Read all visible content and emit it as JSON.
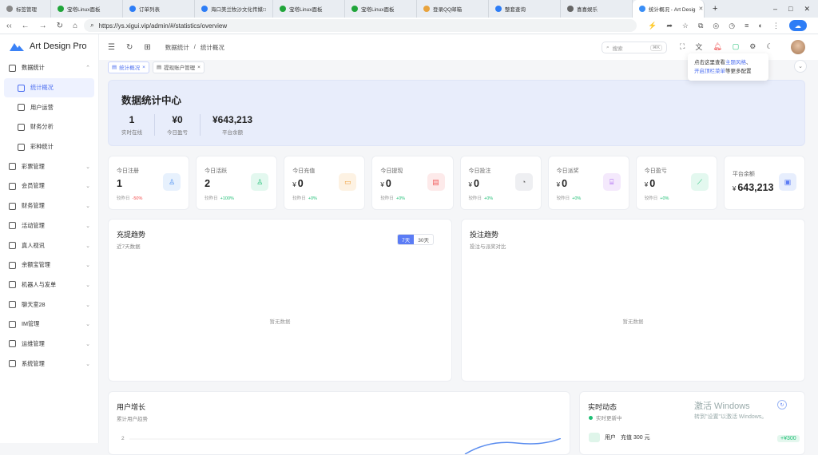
{
  "browser": {
    "tabs": [
      {
        "label": "标签管理",
        "color": "#888888"
      },
      {
        "label": "宝塔Linux面板",
        "color": "#20a53a"
      },
      {
        "label": "订单列表",
        "color": "#2d7df6"
      },
      {
        "label": "海口美兰牧沙文化传媒□",
        "color": "#2d7df6"
      },
      {
        "label": "宝塔Linux面板",
        "color": "#20a53a"
      },
      {
        "label": "宝塔Linux面板",
        "color": "#20a53a"
      },
      {
        "label": "登录QQ邮箱",
        "color": "#e8a33d"
      },
      {
        "label": "整套查询",
        "color": "#2d7df6"
      },
      {
        "label": "喜喜娱乐",
        "color": "#666666"
      },
      {
        "label": "统计概况 - Art Desig",
        "color": "#3a8ef6"
      }
    ],
    "url": "https://ys.xigui.vip/admin/#/statistics/overview"
  },
  "app": {
    "name": "Art Design Pro",
    "accent": "#4d6ff0"
  },
  "sidebar": {
    "items": [
      {
        "label": "数据统计",
        "icon": "chart-icon",
        "sub": false,
        "active": false,
        "expanded": true
      },
      {
        "label": "统计概况",
        "icon": "grid-icon",
        "sub": true,
        "active": true
      },
      {
        "label": "用户运营",
        "icon": "user-icon",
        "sub": true,
        "active": false
      },
      {
        "label": "财务分析",
        "icon": "coin-icon",
        "sub": true,
        "active": false
      },
      {
        "label": "彩种统计",
        "icon": "list-icon",
        "sub": true,
        "active": false
      },
      {
        "label": "彩票管理",
        "icon": "ticket-icon",
        "sub": false,
        "active": false
      },
      {
        "label": "会员管理",
        "icon": "member-icon",
        "sub": false,
        "active": false
      },
      {
        "label": "财务管理",
        "icon": "wallet-icon",
        "sub": false,
        "active": false
      },
      {
        "label": "活动管理",
        "icon": "gift-icon",
        "sub": false,
        "active": false
      },
      {
        "label": "真人视讯",
        "icon": "video-icon",
        "sub": false,
        "active": false
      },
      {
        "label": "余额宝管理",
        "icon": "bank-icon",
        "sub": false,
        "active": false
      },
      {
        "label": "机器人与发单",
        "icon": "robot-icon",
        "sub": false,
        "active": false
      },
      {
        "label": "聊天室28",
        "icon": "chat-icon",
        "sub": false,
        "active": false
      },
      {
        "label": "IM管理",
        "icon": "message-icon",
        "sub": false,
        "active": false
      },
      {
        "label": "运维管理",
        "icon": "tools-icon",
        "sub": false,
        "active": false
      },
      {
        "label": "系统管理",
        "icon": "settings-icon",
        "sub": false,
        "active": false
      }
    ]
  },
  "header": {
    "breadcrumb": [
      "数据统计",
      "统计概况"
    ],
    "search_placeholder": "搜索",
    "search_kbd": "⌘K"
  },
  "tooltip": {
    "line1_prefix": "点击这里查看",
    "line1_link": "主题风格",
    "line1_suffix": "、",
    "line2_link": "开启顶栏菜单",
    "line2_suffix": "等更多配置"
  },
  "open_tabs": [
    {
      "label": "统计概况",
      "active": true
    },
    {
      "label": "提现账户管理",
      "active": false
    }
  ],
  "banner": {
    "title": "数据统计中心",
    "stats": [
      {
        "value": "1",
        "label": "实时在线"
      },
      {
        "value": "¥0",
        "label": "今日盈亏"
      },
      {
        "value": "¥643,213",
        "label": "平台余额"
      }
    ]
  },
  "cards": [
    {
      "title": "今日注册",
      "value": "1",
      "currency": "",
      "compare_label": "较昨日",
      "compare": "-50%",
      "trend": "neg",
      "icon": "user-icon",
      "bg": "#e7f1fd",
      "fg": "#4a8ff0"
    },
    {
      "title": "今日活跃",
      "value": "2",
      "currency": "",
      "compare_label": "较昨日",
      "compare": "+100%",
      "trend": "pos",
      "icon": "user-check-icon",
      "bg": "#e3f8ef",
      "fg": "#1fbf75"
    },
    {
      "title": "今日充值",
      "value": "0",
      "currency": "¥",
      "compare_label": "较昨日",
      "compare": "+0%",
      "trend": "pos",
      "icon": "wallet-icon",
      "bg": "#fdf2e3",
      "fg": "#f0a13a"
    },
    {
      "title": "今日提现",
      "value": "0",
      "currency": "¥",
      "compare_label": "较昨日",
      "compare": "+0%",
      "trend": "pos",
      "icon": "card-icon",
      "bg": "#fdeaea",
      "fg": "#f15b5b"
    },
    {
      "title": "今日投注",
      "value": "0",
      "currency": "¥",
      "compare_label": "较昨日",
      "compare": "+0%",
      "trend": "pos",
      "icon": "pie-icon",
      "bg": "#eeeff2",
      "fg": "#666666"
    },
    {
      "title": "今日派奖",
      "value": "0",
      "currency": "¥",
      "compare_label": "较昨日",
      "compare": "+0%",
      "trend": "pos",
      "icon": "gift-icon",
      "bg": "#f4e9fc",
      "fg": "#a45bf0"
    },
    {
      "title": "今日盈亏",
      "value": "0",
      "currency": "¥",
      "compare_label": "较昨日",
      "compare": "+0%",
      "trend": "pos",
      "icon": "line-chart-icon",
      "bg": "#e3f8ef",
      "fg": "#1fbf75"
    },
    {
      "title": "平台余额",
      "value": "643,213",
      "currency": "¥",
      "compare_label": "",
      "compare": "",
      "trend": "",
      "icon": "balance-icon",
      "bg": "#e7eefd",
      "fg": "#5b7cf5"
    }
  ],
  "panels": {
    "recharge": {
      "title": "充提趋势",
      "subtitle": "近7天数据",
      "empty": "暂无数据",
      "ranges": [
        "7天",
        "30天"
      ],
      "selected": "7天"
    },
    "betting": {
      "title": "投注趋势",
      "subtitle": "投注与派奖对比",
      "empty": "暂无数据"
    },
    "growth": {
      "title": "用户增长",
      "subtitle": "累计用户趋势",
      "y_tick": "2"
    },
    "realtime": {
      "title": "实时动态",
      "status": "实时更新中",
      "feed_user": "用户",
      "feed_text": "充值 300 元",
      "feed_amount": "+¥300"
    }
  },
  "watermark": {
    "line1": "激活 Windows",
    "line2": "转到\"设置\"以激活 Windows。"
  }
}
